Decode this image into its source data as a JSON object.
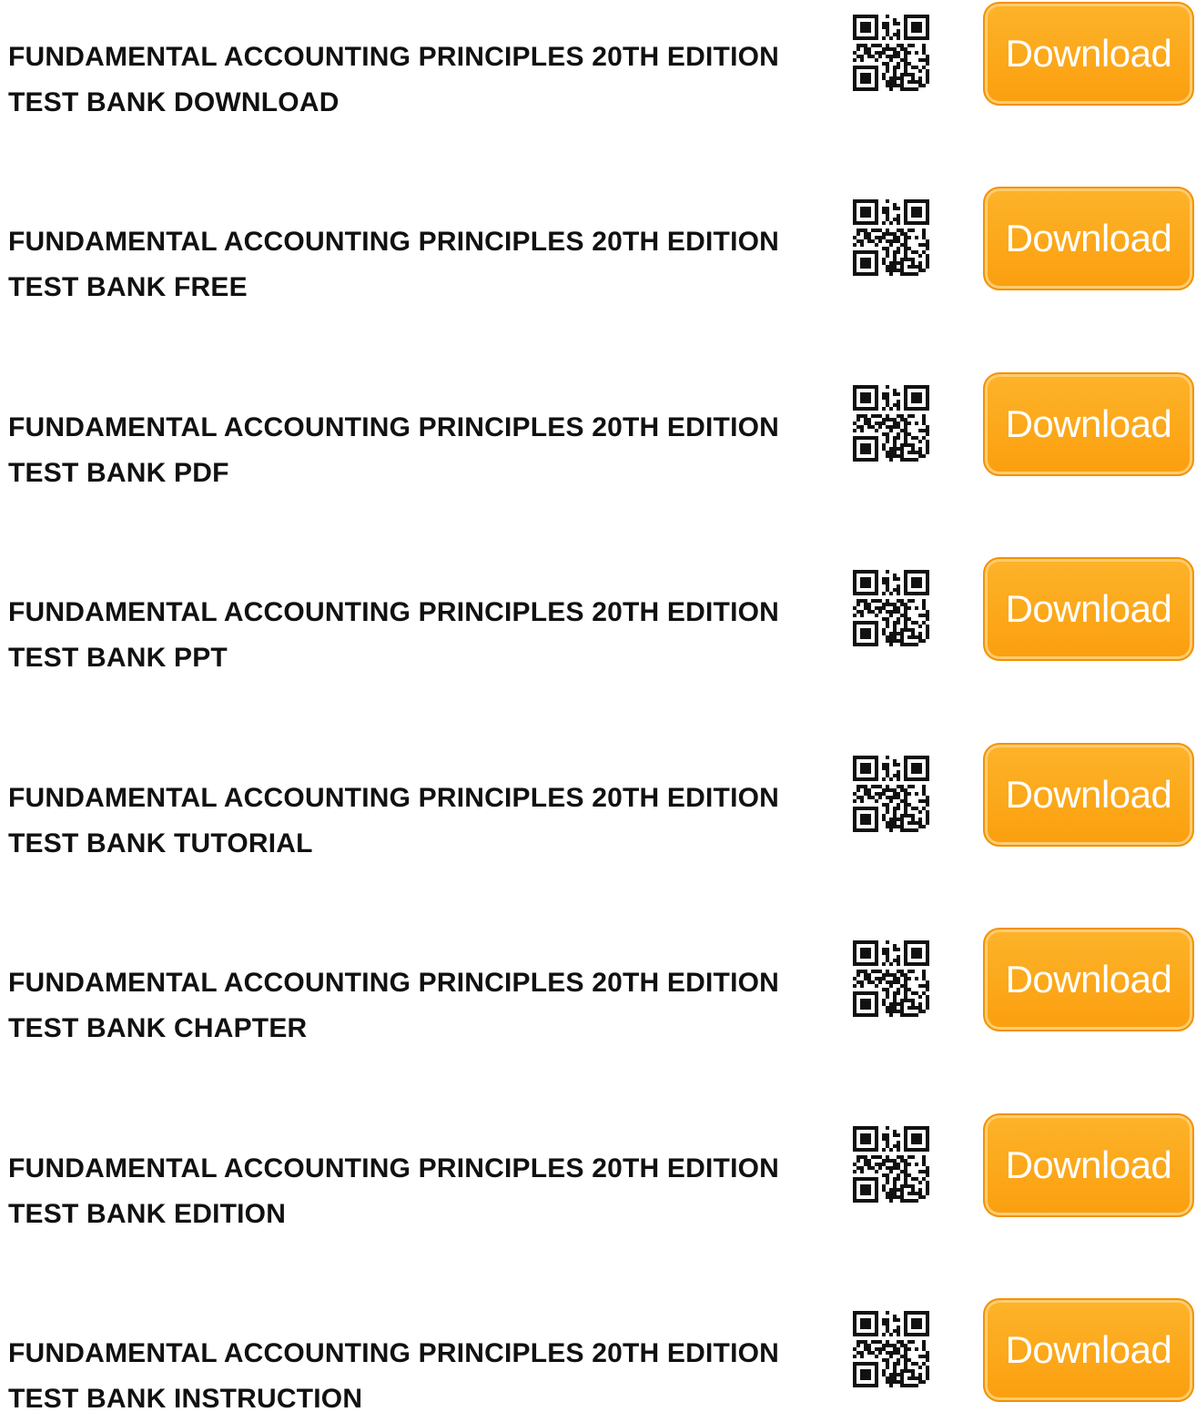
{
  "items": [
    {
      "title_line1": "FUNDAMENTAL ACCOUNTING PRINCIPLES 20TH EDITION",
      "title_line2": "TEST BANK DOWNLOAD",
      "button_label": "Download"
    },
    {
      "title_line1": "FUNDAMENTAL ACCOUNTING PRINCIPLES 20TH EDITION",
      "title_line2": "TEST BANK FREE",
      "button_label": "Download"
    },
    {
      "title_line1": "FUNDAMENTAL ACCOUNTING PRINCIPLES 20TH EDITION",
      "title_line2": "TEST BANK PDF",
      "button_label": "Download"
    },
    {
      "title_line1": "FUNDAMENTAL ACCOUNTING PRINCIPLES 20TH EDITION",
      "title_line2": "TEST BANK PPT",
      "button_label": "Download"
    },
    {
      "title_line1": "FUNDAMENTAL ACCOUNTING PRINCIPLES 20TH EDITION",
      "title_line2": "TEST BANK TUTORIAL",
      "button_label": "Download"
    },
    {
      "title_line1": "FUNDAMENTAL ACCOUNTING PRINCIPLES 20TH EDITION",
      "title_line2": "TEST BANK CHAPTER",
      "button_label": "Download"
    },
    {
      "title_line1": "FUNDAMENTAL ACCOUNTING PRINCIPLES 20TH EDITION",
      "title_line2": "TEST BANK EDITION",
      "button_label": "Download"
    },
    {
      "title_line1": "FUNDAMENTAL ACCOUNTING PRINCIPLES 20TH EDITION",
      "title_line2": "TEST BANK INSTRUCTION",
      "button_label": "Download"
    }
  ],
  "icons": {
    "qr": "qr-code-icon"
  },
  "colors": {
    "button_fill": "#fca61a",
    "button_border": "#f39200",
    "button_text": "#ffffff",
    "title_text": "#111111",
    "background": "#ffffff"
  }
}
